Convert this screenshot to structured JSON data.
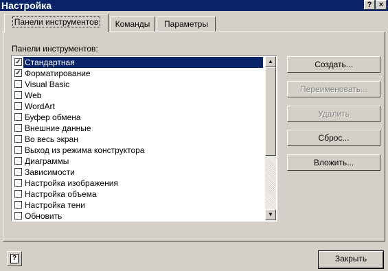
{
  "window": {
    "title": "Настройка",
    "help_btn": "?",
    "close_btn": "×"
  },
  "tabs": [
    {
      "label": "Панели инструментов",
      "active": true
    },
    {
      "label": "Команды",
      "active": false
    },
    {
      "label": "Параметры",
      "active": false
    }
  ],
  "toolbars_label": "Панели инструментов:",
  "list": [
    {
      "label": "Стандартная",
      "checked": true,
      "selected": true
    },
    {
      "label": "Форматирование",
      "checked": true
    },
    {
      "label": "Visual Basic",
      "checked": false
    },
    {
      "label": "Web",
      "checked": false
    },
    {
      "label": "WordArt",
      "checked": false
    },
    {
      "label": "Буфер обмена",
      "checked": false
    },
    {
      "label": "Внешние данные",
      "checked": false
    },
    {
      "label": "Во весь экран",
      "checked": false
    },
    {
      "label": "Выход из режима конструктора",
      "checked": false
    },
    {
      "label": "Диаграммы",
      "checked": false
    },
    {
      "label": "Зависимости",
      "checked": false
    },
    {
      "label": "Настройка изображения",
      "checked": false
    },
    {
      "label": "Настройка объема",
      "checked": false
    },
    {
      "label": "Настройка тени",
      "checked": false
    },
    {
      "label": "Обновить",
      "checked": false
    }
  ],
  "buttons": {
    "create": "Создать...",
    "rename": "Переименовать...",
    "delete": "Удалить",
    "reset": "Сброс...",
    "attach": "Вложить..."
  },
  "footer": {
    "close": "Закрыть"
  },
  "scroll_icons": {
    "up": "arrow-up-icon",
    "down": "arrow-down-icon"
  }
}
